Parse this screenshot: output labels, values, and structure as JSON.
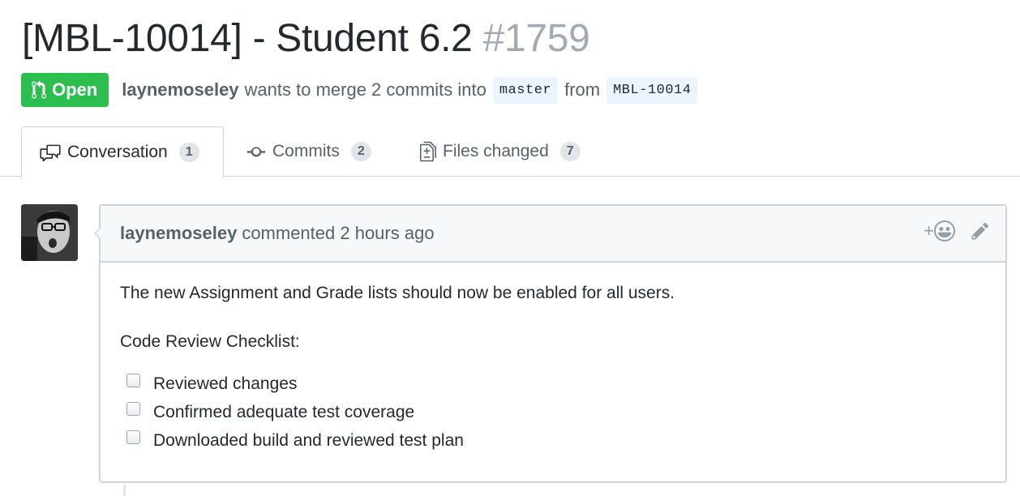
{
  "pr": {
    "title": "[MBL-10014] - Student 6.2",
    "number": "#1759",
    "state": "Open",
    "author": "laynemoseley",
    "merge_text": "wants to merge 2 commits into",
    "base_branch": "master",
    "from_text": "from",
    "head_branch": "MBL-10014"
  },
  "tabs": [
    {
      "label": "Conversation",
      "count": "1",
      "icon": "comment-discussion-icon"
    },
    {
      "label": "Commits",
      "count": "2",
      "icon": "git-commit-icon"
    },
    {
      "label": "Files changed",
      "count": "7",
      "icon": "file-diff-icon"
    }
  ],
  "comment": {
    "author": "laynemoseley",
    "meta": "commented 2 hours ago",
    "reaction_plus": "+",
    "body": "The new Assignment and Grade lists should now be enabled for all users.",
    "checklist_title": "Code Review Checklist:",
    "checklist": [
      {
        "label": "Reviewed changes",
        "checked": false
      },
      {
        "label": "Confirmed adequate test coverage",
        "checked": false
      },
      {
        "label": "Downloaded build and reviewed test plan",
        "checked": false
      }
    ]
  },
  "colors": {
    "open_green": "#2cbe4e",
    "branch_bg": "#eaf5ff",
    "muted": "#586069",
    "border": "#d1d5da"
  }
}
